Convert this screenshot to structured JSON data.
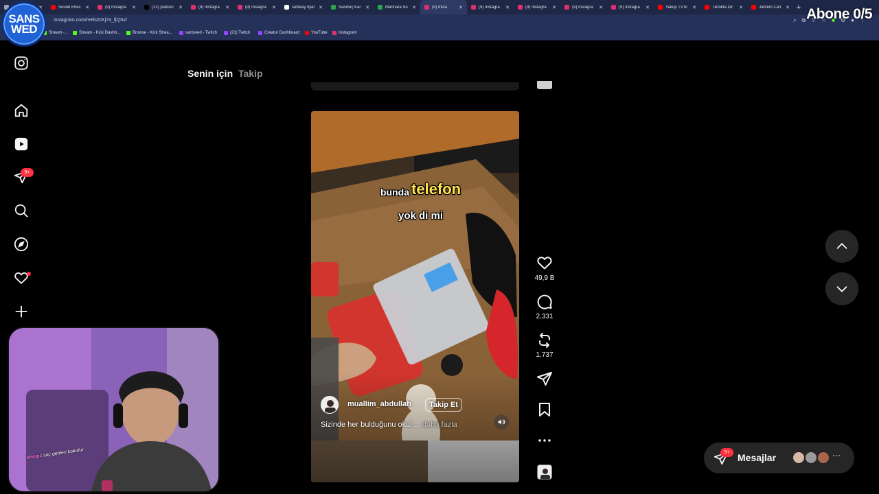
{
  "browser": {
    "tabs": [
      {
        "label": "",
        "color": "#9aa3b8"
      },
      {
        "label": "Sound Effec",
        "color": "#ff0000"
      },
      {
        "label": "(9) Instagra",
        "color": "#e1306c"
      },
      {
        "label": "(12) platcon",
        "color": "#000000"
      },
      {
        "label": "(9) Instagra",
        "color": "#e1306c"
      },
      {
        "label": "(9) Instagra",
        "color": "#e1306c"
      },
      {
        "label": "subway fiyat",
        "color": "#ffffff"
      },
      {
        "label": "Sandviç Kar",
        "color": "#2da44e"
      },
      {
        "label": "Marinara Su",
        "color": "#2da44e"
      },
      {
        "label": "(9) Insta",
        "color": "#e1306c",
        "active": true
      },
      {
        "label": "(9) Instagra",
        "color": "#e1306c"
      },
      {
        "label": "(9) Instagra",
        "color": "#e1306c"
      },
      {
        "label": "(9) Instagra",
        "color": "#e1306c"
      },
      {
        "label": "(9) Instagra",
        "color": "#e1306c"
      },
      {
        "label": "Yakup TV'ni",
        "color": "#ff0000"
      },
      {
        "label": "Tiktokta Dir",
        "color": "#ff0000"
      },
      {
        "label": "Jahrein Can",
        "color": "#ff0000"
      }
    ],
    "url": "instagram.com/reels/DXj7a_fjQSx/",
    "bookmarks": [
      {
        "label": "Stream -...",
        "color": "#53fc18"
      },
      {
        "label": "Stream - Kick Dashb...",
        "color": "#53fc18"
      },
      {
        "label": "Browse - Kick Strea...",
        "color": "#53fc18"
      },
      {
        "label": "sanswed - Twitch",
        "color": "#9146ff"
      },
      {
        "label": "(21) Twitch",
        "color": "#9146ff"
      },
      {
        "label": "Creator Dashboard",
        "color": "#9146ff"
      },
      {
        "label": "YouTube",
        "color": "#ff0000"
      },
      {
        "label": "Instagram",
        "color": "#e1306c"
      }
    ]
  },
  "overlay": {
    "logo_line1": "SANS",
    "logo_line2": "WED",
    "sub_goal": "Abone 0/5"
  },
  "sidebar": {
    "icons": [
      "instagram-logo-icon",
      "home-icon",
      "reels-icon",
      "direct-icon",
      "search-icon",
      "explore-icon",
      "notifications-icon",
      "create-icon"
    ],
    "direct_badge": "9+"
  },
  "feed_tabs": {
    "for_you": "Senin için",
    "following": "Takip"
  },
  "reel": {
    "caption_small": "bunda",
    "caption_big": "telefon",
    "caption_line2": "yok di mi",
    "username": "muallim_abdullah",
    "follow_label": "Takip Et",
    "description": "Sizinde her bulduğunu okul ...",
    "more_label": "daha fazla"
  },
  "actions": {
    "likes": "49,9 B",
    "comments": "2.331",
    "reposts": "1.737"
  },
  "messages": {
    "label": "Mesajlar",
    "badge": "9+"
  },
  "webcam": {
    "chat_user": "shmpi",
    "chat_text": ": saç genleri kotudur"
  },
  "colors": {
    "accent_red": "#ff3040",
    "panel": "#262626",
    "caption_yellow": "#ffe34d"
  }
}
